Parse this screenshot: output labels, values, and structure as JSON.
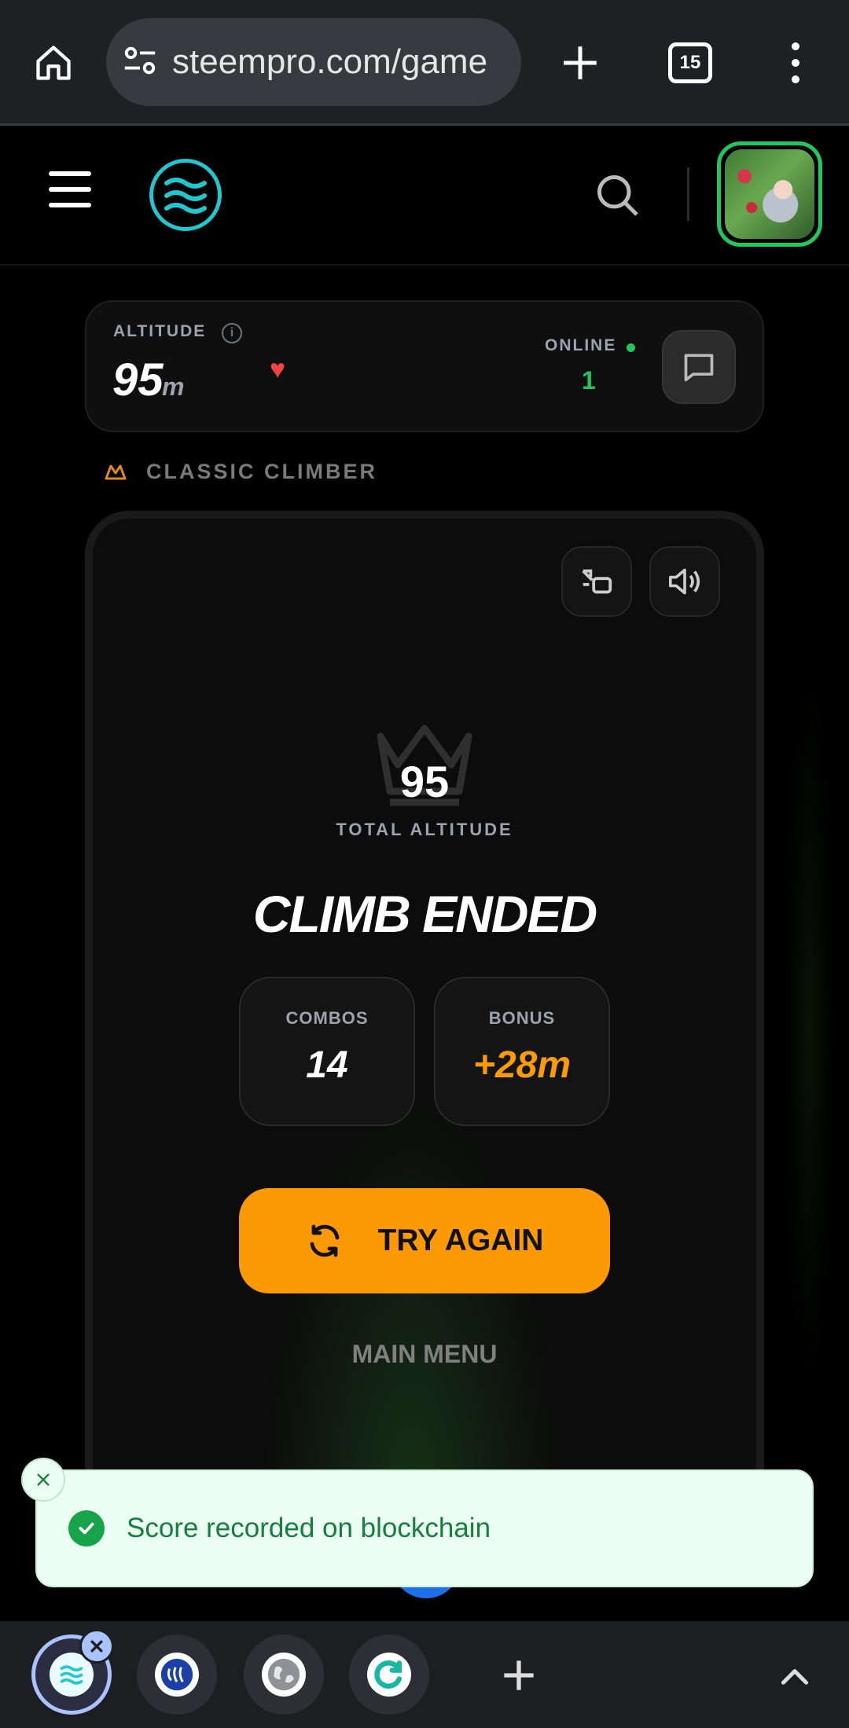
{
  "browser": {
    "url": "steempro.com/game",
    "tab_count": "15",
    "icons": [
      "home-icon",
      "site-settings-icon",
      "plus-icon",
      "tab-switcher-icon",
      "more-vert-icon"
    ]
  },
  "header": {
    "icons": [
      "hamburger-icon",
      "steempro-logo",
      "search-icon",
      "avatar"
    ],
    "accent": "#22c6cf",
    "avatar_ring": "#22c55e"
  },
  "stats": {
    "altitude_label": "ALTITUDE",
    "info_glyph": "i",
    "altitude_value": "95",
    "altitude_unit": "m",
    "heart_glyph": "♥",
    "online_label": "ONLINE",
    "online_count": "1"
  },
  "mode": {
    "label": "CLASSIC CLIMBER"
  },
  "game": {
    "total_value": "95",
    "total_label": "TOTAL ALTITUDE",
    "title": "CLIMB ENDED",
    "combos_label": "COMBOS",
    "combos_value": "14",
    "bonus_label": "BONUS",
    "bonus_value": "+28m",
    "try_again_label": "TRY AGAIN",
    "main_menu_label": "MAIN MENU",
    "accent": "#fb9a04"
  },
  "toast": {
    "message": "Score recorded on blockchain",
    "color": "#15803d"
  },
  "tab_strip": {
    "tabs": [
      "steempro-tab",
      "steemit-tab",
      "globe-tab",
      "refresh-tab"
    ],
    "icons": [
      "plus-icon",
      "chevron-up-icon"
    ]
  }
}
